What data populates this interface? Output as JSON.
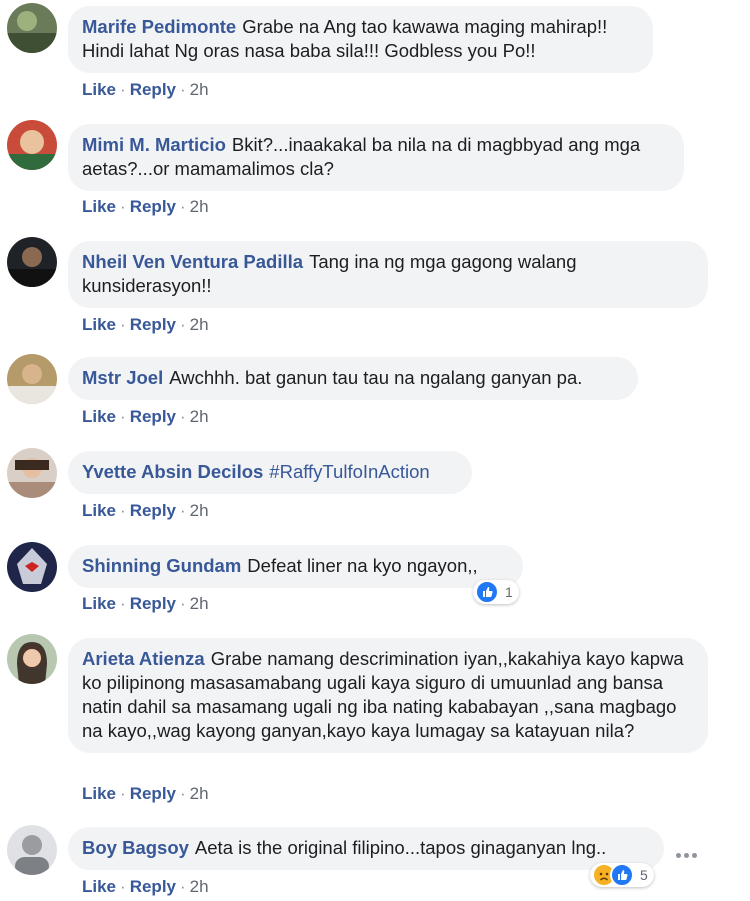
{
  "labels": {
    "like": "Like",
    "reply": "Reply",
    "sep": "·"
  },
  "colors": {
    "name": "#385898",
    "bubble": "#f2f3f5",
    "like_react": "#2078f4",
    "sad_react": "#f7b125"
  },
  "comments": [
    {
      "author": "Marife Pedimonte",
      "text": "Grabe na Ang tao kawawa maging mahirap!! Hindi lahat Ng oras nasa baba sila!!! Godbless you Po!!",
      "time": "2h"
    },
    {
      "author": "Mimi M. Marticio",
      "text": "Bkit?...inaakakal ba nila na di magbbyad ang mga aetas?...or mamamalimos cla?",
      "time": "2h"
    },
    {
      "author": "Nheil Ven Ventura Padilla",
      "text": "Tang ina ng mga gagong walang kunsiderasyon!!",
      "time": "2h"
    },
    {
      "author": "Mstr Joel",
      "text": "Awchhh. bat ganun tau tau na ngalang ganyan pa.",
      "time": "2h"
    },
    {
      "author": "Yvette Absin Decilos",
      "text": "#RaffyTulfoInAction",
      "time": "2h"
    },
    {
      "author": "Shinning Gundam",
      "text": "Defeat liner na kyo ngayon,,",
      "time": "2h",
      "reaction_count": "1",
      "reaction_icons": [
        "like-reaction-icon"
      ]
    },
    {
      "author": "Arieta Atienza",
      "text": "Grabe namang descrimination iyan,,kakahiya kayo kapwa ko pilipinong masasamabang ugali kaya siguro di umuunlad ang bansa natin dahil sa masamang ugali ng iba nating kababayan ,,sana magbago na kayo,,wag kayong ganyan,kayo kaya lumagay sa katayuan nila?",
      "time": "2h"
    },
    {
      "author": "Boy Bagsoy",
      "text": "Aeta is the original filipino...tapos ginaganyan lng..",
      "time": "2h",
      "reaction_count": "5",
      "reaction_icons": [
        "sad-reaction-icon",
        "like-reaction-icon"
      ]
    }
  ]
}
